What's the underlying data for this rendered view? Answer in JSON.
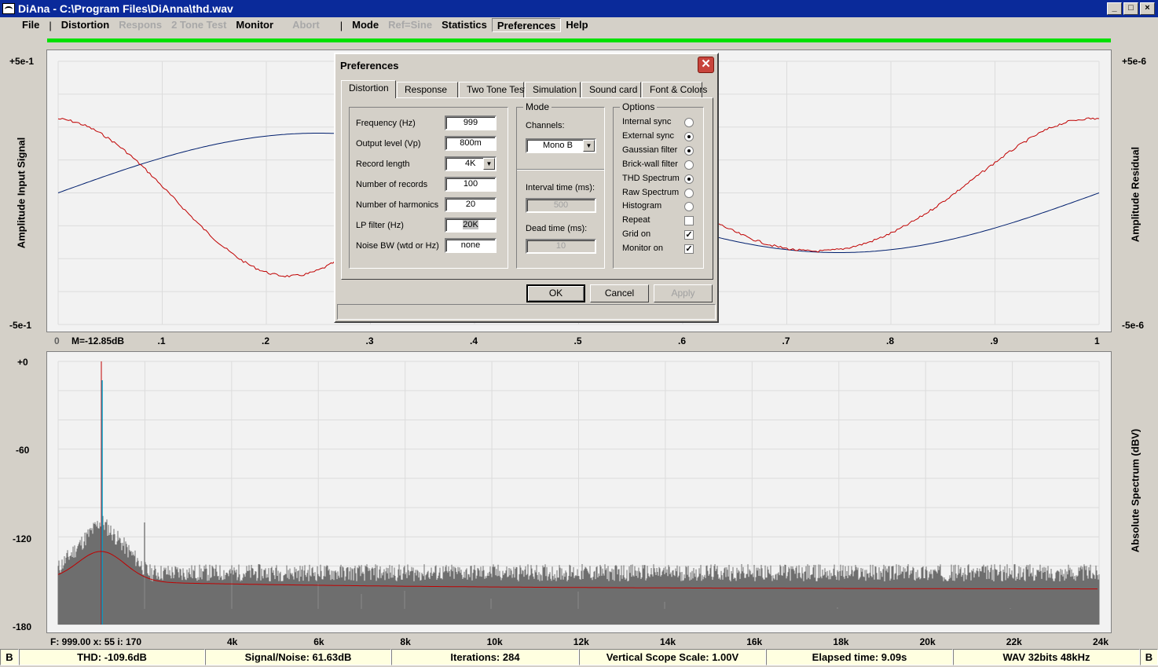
{
  "window": {
    "title": "DiAna - C:\\Program Files\\DiAnna\\thd.wav",
    "minimize": "_",
    "maximize": "□",
    "close": "×"
  },
  "menu": {
    "file": "File",
    "sep1": "|",
    "distortion": "Distortion",
    "respons": "Respons",
    "two_tone": "2 Tone Test",
    "monitor": "Monitor",
    "abort": "Abort",
    "sep2": "|",
    "mode": "Mode",
    "ref_sine": "Ref=Sine",
    "statistics": "Statistics",
    "preferences": "Preferences",
    "help": "Help"
  },
  "top_plot": {
    "left_label": "Amplitude Input Signal",
    "right_label": "Amplitude Residual",
    "y_left_top": "+5e-1",
    "y_left_bottom": "-5e-1",
    "y_right_top": "+5e-6",
    "y_right_bottom": "-5e-6",
    "x_ticks": [
      "0",
      ".1",
      ".2",
      ".3",
      ".4",
      ".5",
      ".6",
      ".7",
      ".8",
      ".9",
      "1"
    ],
    "marker": "M=-12.85dB"
  },
  "bottom_plot": {
    "right_label": "Absolute Spectrum (dBV)",
    "y_ticks": [
      "+0",
      "-60",
      "-120",
      "-180"
    ],
    "x_ticks": [
      "4k",
      "6k",
      "8k",
      "10k",
      "12k",
      "14k",
      "16k",
      "18k",
      "20k",
      "22k",
      "24k"
    ],
    "cursor": "F: 999.00  x: 55  i: 170"
  },
  "status": {
    "left": "B",
    "thd": "THD: -109.6dB",
    "snr": "Signal/Noise:  61.63dB",
    "iterations": "Iterations: 284",
    "scope": "Vertical Scope Scale: 1.00V",
    "elapsed": "Elapsed time: 9.09s",
    "format": "WAV 32bits 48kHz",
    "right": "B"
  },
  "dialog": {
    "title": "Preferences",
    "close": "✕",
    "tabs": [
      "Distortion",
      "Response",
      "Two Tone Test",
      "Simulation",
      "Sound card",
      "Font & Colors"
    ],
    "fields": [
      {
        "label": "Frequency (Hz)",
        "value": "999"
      },
      {
        "label": "Output level (Vp)",
        "value": "800m"
      },
      {
        "label": "Record length",
        "value": "4K"
      },
      {
        "label": "Number of records",
        "value": "100"
      },
      {
        "label": "Number of harmonics",
        "value": "20"
      },
      {
        "label": "LP filter (Hz)",
        "value": "20K"
      },
      {
        "label": "Noise BW (wtd or Hz)",
        "value": "none"
      }
    ],
    "mode": {
      "title": "Mode",
      "channels_label": "Channels:",
      "channels_value": "Mono  B",
      "interval_label": "Interval time (ms):",
      "interval_value": "500",
      "dead_label": "Dead time (ms):",
      "dead_value": "10"
    },
    "options": {
      "title": "Options",
      "items": [
        {
          "label": "Internal sync",
          "type": "radio",
          "checked": false
        },
        {
          "label": "External sync",
          "type": "radio",
          "checked": true
        },
        {
          "label": "Gaussian filter",
          "type": "radio",
          "checked": true
        },
        {
          "label": "Brick-wall filter",
          "type": "radio",
          "checked": false
        },
        {
          "label": "THD Spectrum",
          "type": "radio",
          "checked": true
        },
        {
          "label": "Raw Spectrum",
          "type": "radio",
          "checked": false
        },
        {
          "label": "Histogram",
          "type": "radio",
          "checked": false
        },
        {
          "label": "Repeat",
          "type": "check",
          "checked": false
        },
        {
          "label": "Grid on",
          "type": "check",
          "checked": true
        },
        {
          "label": "Monitor on",
          "type": "check",
          "checked": true
        }
      ]
    },
    "buttons": {
      "ok": "OK",
      "cancel": "Cancel",
      "apply": "Apply"
    }
  },
  "colors": {
    "signal": "#001f6e",
    "residual": "#c00000",
    "spectrum": "#6e6e6e",
    "fundamental": "#00a0c8",
    "progress": "#00e000"
  }
}
